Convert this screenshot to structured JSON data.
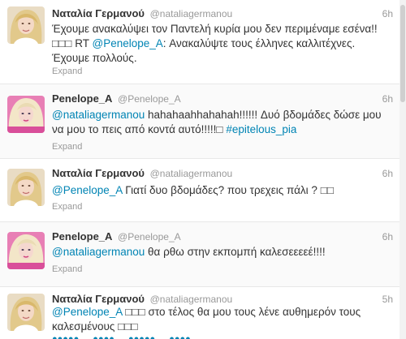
{
  "tweets": [
    {
      "name": "Ναταλία Γερμανού",
      "handle": "@nataliagermanou",
      "time": "6h",
      "text_1": "Έχουμε ανακαλύψει τον Παντελή κυρία μου δεν περιμέναμε εσένα!! □□□ RT ",
      "mention_1": "@Penelope_A",
      "text_2": ": Ανακαλύψτε τους έλληνες καλλιτέχνες. Έχουμε πολλούς.",
      "expand": "Expand",
      "avatar": "blonde-woman-avatar"
    },
    {
      "name": "Penelope_A",
      "handle": "@Penelope_A",
      "time": "6h",
      "mention_1": "@nataliagermanou",
      "text_1": " hahahaahhahahah!!!!!! Δυό βδομάδες δώσε μου να μου το πεις από κοντά αυτό!!!!!□ ",
      "hashtag": "#epitelous_pia",
      "expand": "Expand",
      "avatar": "pink-portrait-avatar"
    },
    {
      "name": "Ναταλία Γερμανού",
      "handle": "@nataliagermanou",
      "time": "6h",
      "mention_1": "@Penelope_A",
      "text_1": " Γιατί δυο βδομάδες? που τρεχεις πάλι ? □□",
      "expand": "Expand",
      "avatar": "blonde-woman-avatar"
    },
    {
      "name": "Penelope_A",
      "handle": "@Penelope_A",
      "time": "6h",
      "mention_1": "@nataliagermanou",
      "text_1": " θα ρθω στην εκπομπή καλεσεεεεέ!!!!",
      "expand": "Expand",
      "avatar": "pink-portrait-avatar"
    },
    {
      "name": "Ναταλία Γερμανού",
      "handle": "@nataliagermanou",
      "time": "5h",
      "mention_1": "@Penelope_A",
      "text_1": " □□□ στο τέλος θα μου τους λένε αυθημερόν τους καλεσμένους □□□",
      "avatar": "blonde-woman-avatar"
    }
  ],
  "colors": {
    "link": "#0084b4",
    "muted": "#999999",
    "text": "#333333",
    "border": "#e8e8e8"
  }
}
